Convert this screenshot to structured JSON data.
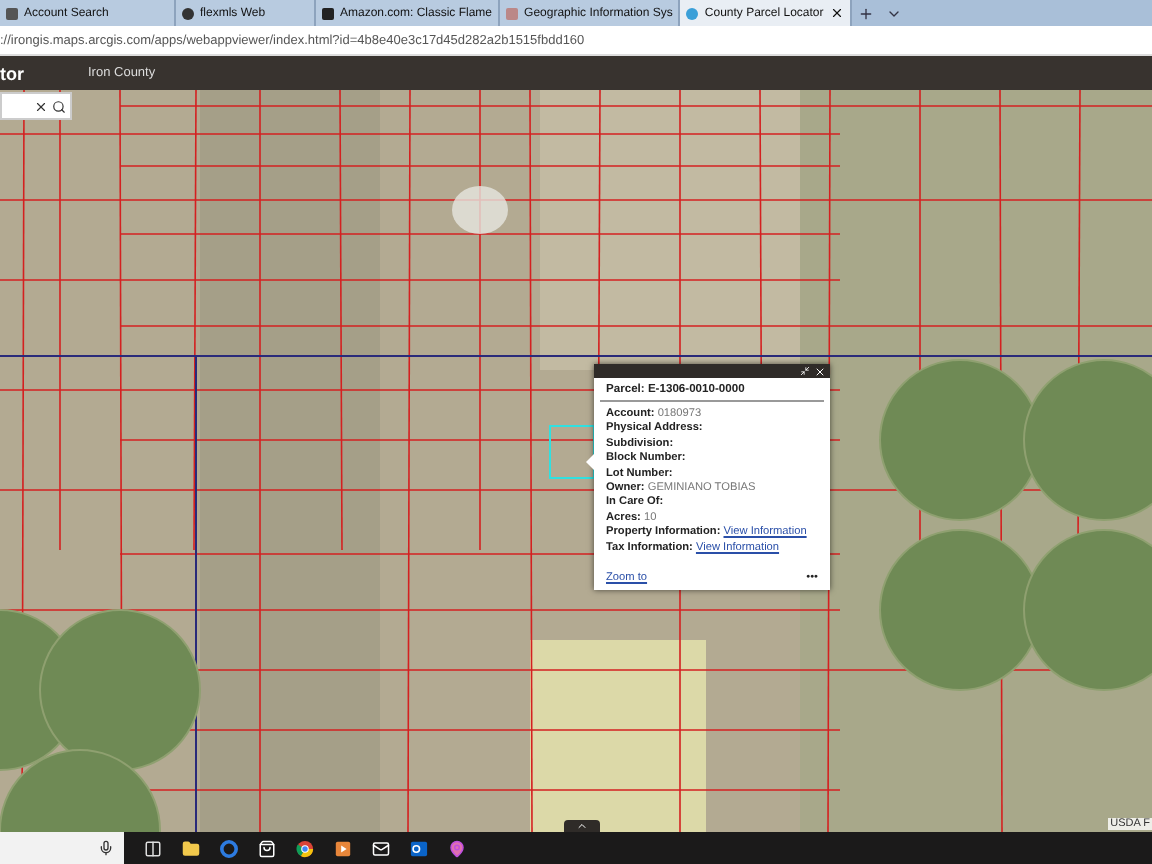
{
  "browser": {
    "tabs": [
      {
        "title": "Account Search",
        "selected": false
      },
      {
        "title": "flexmls Web",
        "selected": false
      },
      {
        "title": "Amazon.com: Classic Flame",
        "selected": false
      },
      {
        "title": "Geographic Information Sys",
        "selected": false
      },
      {
        "title": "County Parcel Locator",
        "selected": true
      }
    ],
    "address": "://irongis.maps.arcgis.com/apps/webappviewer/index.html?id=4b8e40e3c17d45d282a2b1515fbdd160"
  },
  "app": {
    "title": "tor",
    "subtitle": "Iron County"
  },
  "popup": {
    "title": "Parcel: E-1306-0010-0000",
    "fields": [
      {
        "label": "Account:",
        "value": "0180973",
        "kind": "text"
      },
      {
        "label": "Physical Address:",
        "kind": "text"
      },
      {
        "label": "Subdivision:",
        "kind": "text"
      },
      {
        "label": "Block Number:",
        "kind": "text"
      },
      {
        "label": "Lot Number:",
        "kind": "text"
      },
      {
        "label": "Owner:",
        "value": "GEMINIANO TOBIAS",
        "kind": "text"
      },
      {
        "label": "In Care Of:",
        "kind": "text"
      },
      {
        "label": "Acres:",
        "value": "10",
        "kind": "text"
      },
      {
        "label": "Property Information:",
        "value": "View Information",
        "kind": "link"
      },
      {
        "label": "Tax Information:",
        "value": "View Information",
        "kind": "link"
      }
    ],
    "zoom_link": "Zoom to",
    "more": "•••"
  },
  "attribution": "USDA F"
}
